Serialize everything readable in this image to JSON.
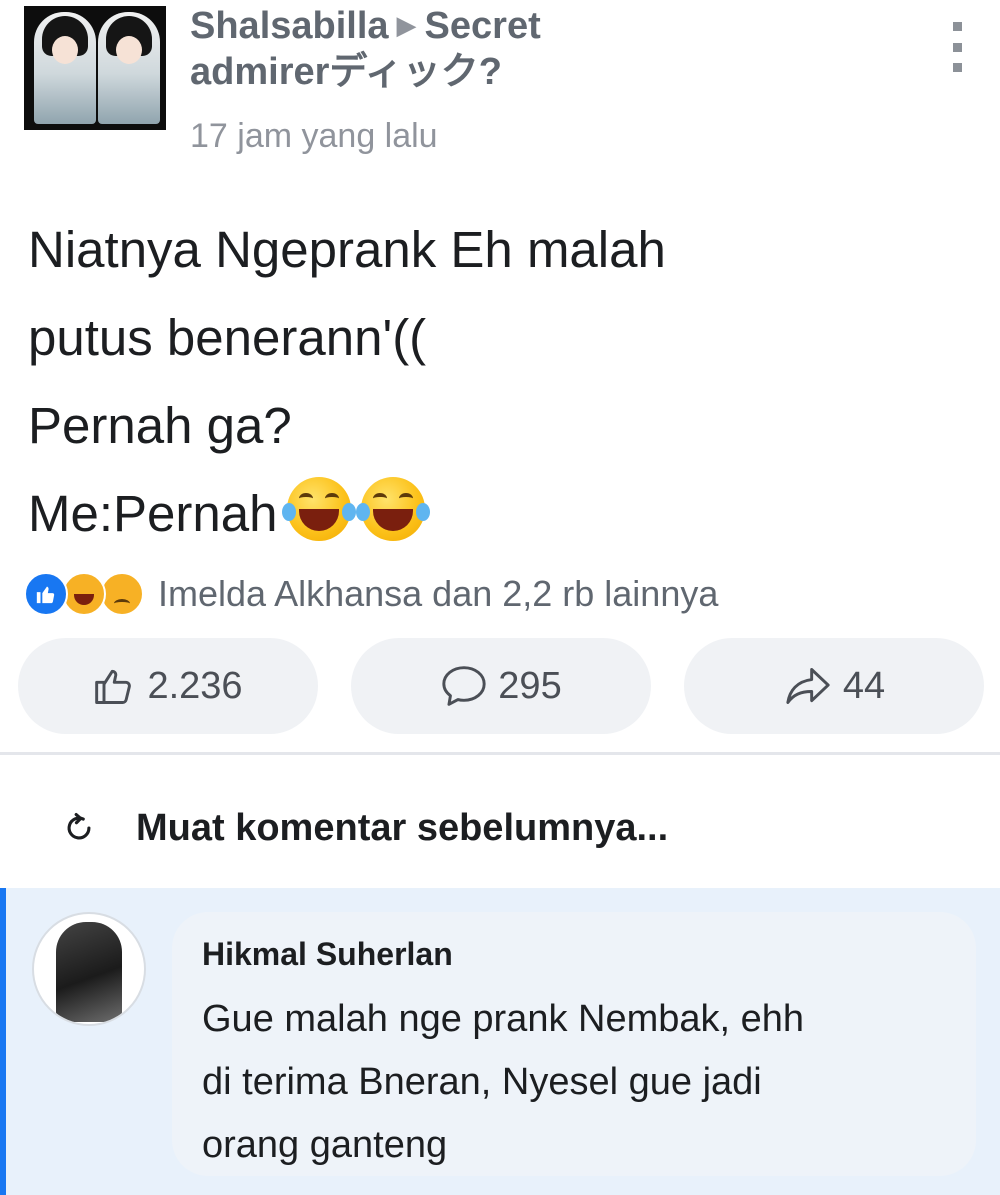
{
  "post": {
    "author": "Shalsabilla",
    "group": "Secret admirerディック?",
    "group_line1": "Secret",
    "group_line2": "admirerディック?",
    "timestamp": "17 jam yang lalu",
    "body_lines": [
      "Niatnya Ngeprank Eh malah",
      "putus benerann'((",
      "Pernah ga?",
      "Me:Pernah"
    ],
    "reactions_summary": "Imelda Alkhansa dan 2,2 rb lainnya",
    "reaction_icons": [
      "like-icon",
      "haha-icon",
      "sad-icon"
    ]
  },
  "actions": {
    "like_count": "2.236",
    "comment_count": "295",
    "share_count": "44"
  },
  "comments": {
    "load_more_label": "Muat komentar sebelumnya...",
    "items": [
      {
        "author": "Hikmal Suherlan",
        "text_lines": [
          "Gue malah nge prank Nembak, ehh",
          "di terima Bneran, Nyesel gue jadi",
          "orang ganteng"
        ]
      }
    ]
  },
  "colors": {
    "accent": "#1877f2",
    "comment_highlight": "#e8f1fb"
  }
}
